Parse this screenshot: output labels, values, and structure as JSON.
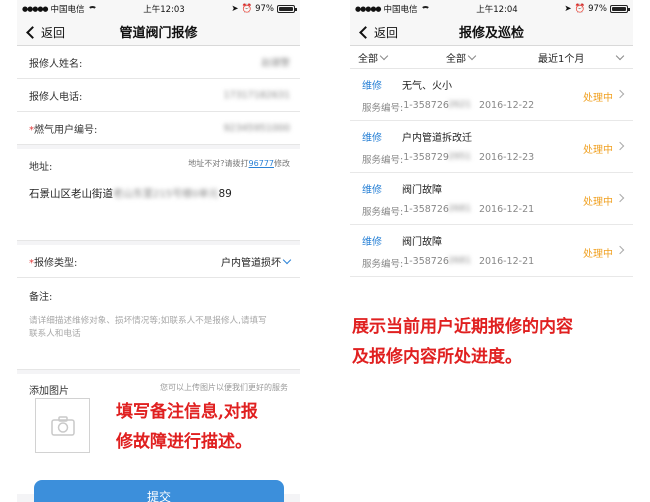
{
  "left": {
    "status": {
      "carrier": "中国电信",
      "time": "上午12:03",
      "battery": "97%"
    },
    "nav": {
      "back": "返回",
      "title": "管道阀门报修"
    },
    "fields": {
      "name_label": "报修人姓名:",
      "name_value": "赵德警",
      "phone_label": "报修人电话:",
      "phone_value": "17317182631",
      "account_label": "燃气用户编号:",
      "account_value": "92345951000",
      "req_mark": "*"
    },
    "address": {
      "label": "地址:",
      "hint_prefix": "地址不对?请拨打",
      "hint_link": "96777",
      "hint_suffix": "修改",
      "value_prefix": "石景山区老山街道",
      "value_hidden": "老山东里215号楼0单元",
      "value_suffix": "89"
    },
    "repair_type": {
      "label": "报修类型:",
      "value": "户内管道损坏"
    },
    "notes": {
      "label": "备注:",
      "placeholder": "请详细描述维修对象、损坏情况等;如联系人不是报修人,请填写联系人和电话"
    },
    "photos": {
      "label": "添加图片",
      "hint": "您可以上传图片以便我们更好的服务"
    },
    "submit": "提交"
  },
  "right": {
    "status": {
      "carrier": "中国电信",
      "time": "上午12:04",
      "battery": "97%"
    },
    "nav": {
      "back": "返回",
      "title": "报修及巡检"
    },
    "filters": [
      "全部",
      "全部",
      "最近1个月"
    ],
    "records": [
      {
        "type": "维修",
        "title": "无气、火小",
        "service_label": "服务编号:",
        "service_no": "1-35872621",
        "service_shown": "1-358726",
        "date": "2016-12-22",
        "status": "处理中"
      },
      {
        "type": "维修",
        "title": "户内管道拆改迁",
        "service_label": "服务编号:",
        "service_no": "1-35872951",
        "service_shown": "1-358729",
        "date": "2016-12-23",
        "status": "处理中"
      },
      {
        "type": "维修",
        "title": "阀门故障",
        "service_label": "服务编号:",
        "service_no": "1-35872681",
        "service_shown": "1-358726",
        "date": "2016-12-21",
        "status": "处理中"
      },
      {
        "type": "维修",
        "title": "阀门故障",
        "service_label": "服务编号:",
        "service_no": "1-35872681",
        "service_shown": "1-358726",
        "date": "2016-12-21",
        "status": "处理中"
      }
    ]
  },
  "annotations": {
    "left_line1": "填写备注信息,对报",
    "left_line2": "修故障进行描述。",
    "right_line1": "展示当前用户近期报修的内容",
    "right_line2": "及报修内容所处进度。"
  },
  "colors": {
    "accent": "#2a82d6",
    "status_orange": "#f0a020",
    "callout_red": "#e02020",
    "submit_blue": "#3c8fdb"
  }
}
